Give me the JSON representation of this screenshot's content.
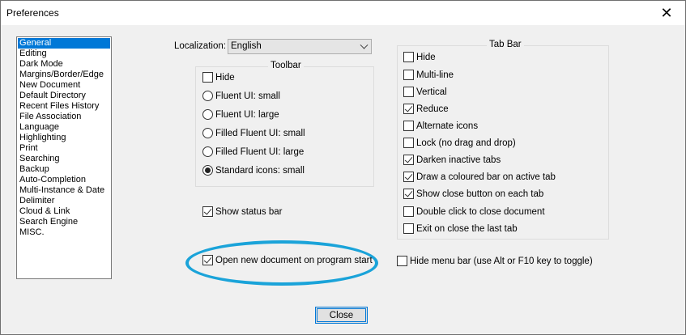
{
  "window": {
    "title": "Preferences"
  },
  "sidebar": {
    "items": [
      {
        "label": "General",
        "selected": true
      },
      {
        "label": "Editing"
      },
      {
        "label": "Dark Mode"
      },
      {
        "label": "Margins/Border/Edge"
      },
      {
        "label": "New Document"
      },
      {
        "label": "Default Directory"
      },
      {
        "label": "Recent Files History"
      },
      {
        "label": "File Association"
      },
      {
        "label": "Language"
      },
      {
        "label": "Highlighting"
      },
      {
        "label": "Print"
      },
      {
        "label": "Searching"
      },
      {
        "label": "Backup"
      },
      {
        "label": "Auto-Completion"
      },
      {
        "label": "Multi-Instance & Date"
      },
      {
        "label": "Delimiter"
      },
      {
        "label": "Cloud & Link"
      },
      {
        "label": "Search Engine"
      },
      {
        "label": "MISC."
      }
    ]
  },
  "localization": {
    "label": "Localization:",
    "value": "English"
  },
  "toolbar": {
    "title": "Toolbar",
    "hide": {
      "label": "Hide",
      "checked": false
    },
    "icon_options": [
      {
        "label": "Fluent UI: small",
        "selected": false
      },
      {
        "label": "Fluent UI: large",
        "selected": false
      },
      {
        "label": "Filled Fluent UI: small",
        "selected": false
      },
      {
        "label": "Filled Fluent UI: large",
        "selected": false
      },
      {
        "label": "Standard icons: small",
        "selected": true
      }
    ]
  },
  "status_bar": {
    "label": "Show status bar",
    "checked": true
  },
  "open_new_doc": {
    "label": "Open new document on program start",
    "checked": true
  },
  "tab_bar": {
    "title": "Tab Bar",
    "options": [
      {
        "label": "Hide",
        "checked": false
      },
      {
        "label": "Multi-line",
        "checked": false
      },
      {
        "label": "Vertical",
        "checked": false
      },
      {
        "label": "Reduce",
        "checked": true
      },
      {
        "label": "Alternate icons",
        "checked": false
      },
      {
        "label": "Lock (no drag and drop)",
        "checked": false
      },
      {
        "label": "Darken inactive tabs",
        "checked": true
      },
      {
        "label": "Draw a coloured bar on active tab",
        "checked": true
      },
      {
        "label": "Show close button on each tab",
        "checked": true
      },
      {
        "label": "Double click to close document",
        "checked": false
      },
      {
        "label": "Exit on close the last tab",
        "checked": false
      }
    ]
  },
  "menu_bar": {
    "label": "Hide menu bar (use Alt or F10 key to toggle)",
    "checked": false
  },
  "buttons": {
    "close": "Close"
  },
  "colors": {
    "selection": "#0078d7",
    "highlight_ellipse": "#1aa3d9"
  }
}
